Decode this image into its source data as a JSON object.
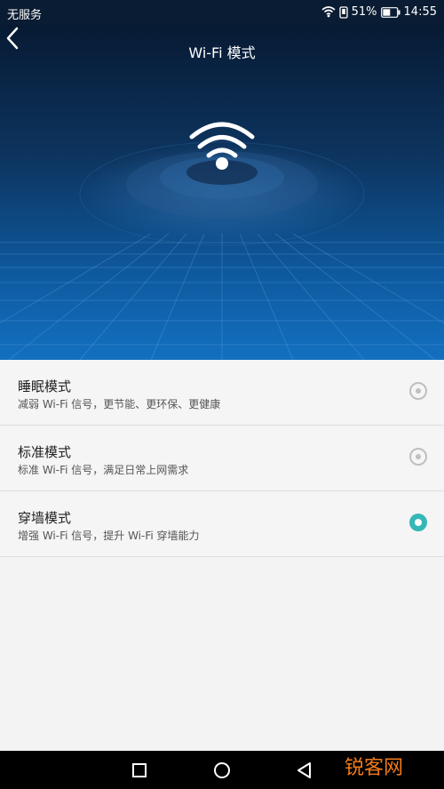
{
  "status": {
    "carrier": "无服务",
    "battery": "51%",
    "time": "14:55"
  },
  "header": {
    "title": "Wi-Fi 模式"
  },
  "modes": [
    {
      "name": "睡眠模式",
      "desc": "减弱 Wi-Fi 信号，更节能、更环保、更健康",
      "selected": false
    },
    {
      "name": "标准模式",
      "desc": "标准 Wi-Fi 信号，满足日常上网需求",
      "selected": false
    },
    {
      "name": "穿墙模式",
      "desc": "增强 Wi-Fi 信号，提升 Wi-Fi 穿墙能力",
      "selected": true
    }
  ],
  "colors": {
    "accent": "#35b7b7",
    "hero_top": "#071a33",
    "hero_bottom": "#1370bf"
  },
  "watermark": "锐客网",
  "icons": [
    "back-arrow-icon",
    "wifi-icon",
    "battery-icon",
    "square-icon",
    "circle-icon",
    "triangle-back-icon"
  ]
}
